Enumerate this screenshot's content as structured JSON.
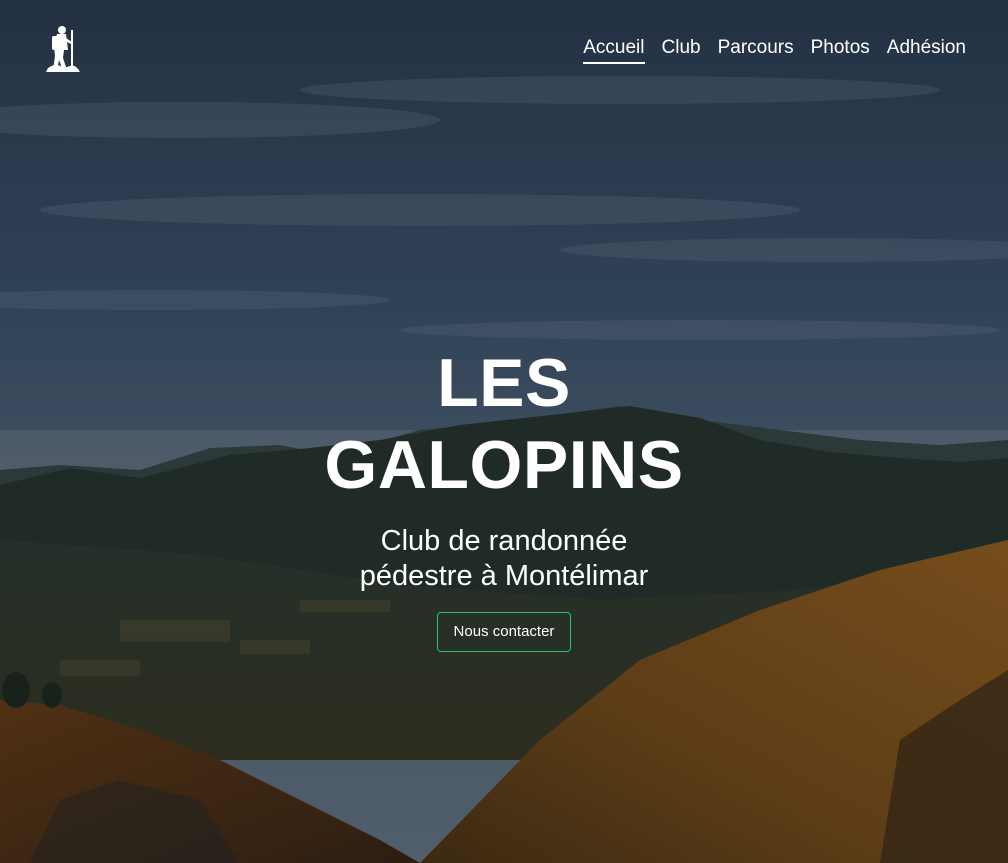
{
  "site": {
    "logo_icon": "hiker-icon"
  },
  "nav": {
    "items": [
      {
        "label": "Accueil",
        "active": true
      },
      {
        "label": "Club",
        "active": false
      },
      {
        "label": "Parcours",
        "active": false
      },
      {
        "label": "Photos",
        "active": false
      },
      {
        "label": "Adhésion",
        "active": false
      }
    ]
  },
  "hero": {
    "title_line1": "LES",
    "title_line2": "GALOPINS",
    "subtitle_line1": "Club de randonnée",
    "subtitle_line2": "pédestre à Montélimar",
    "cta_label": "Nous contacter"
  },
  "colors": {
    "text": "#ffffff",
    "cta_border": "#22c55e",
    "sky": "#3d5168",
    "hills": "#1f2b22",
    "autumn_slope": "#8a5a1c"
  }
}
